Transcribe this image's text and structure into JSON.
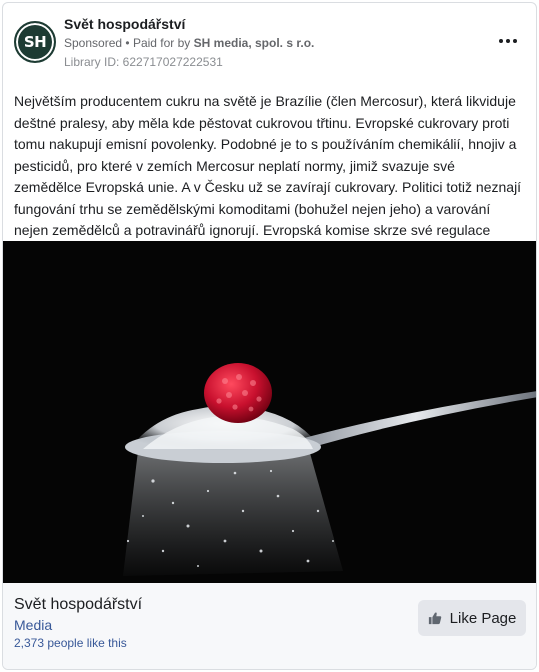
{
  "header": {
    "page_name": "Svět hospodářství",
    "avatar_text": "SH",
    "sponsored_label": "Sponsored",
    "separator": "•",
    "paid_for_prefix": "Paid for by",
    "paid_for_by": "SH media, spol. s r.o.",
    "library_id": "Library ID: 622717027222531",
    "more_icon": "more-horizontal-icon"
  },
  "post": {
    "text": "Největším producentem cukru na světě je Brazílie (člen Mercosur), která likviduje deštné pralesy, aby měla kde pěstovat cukrovou třtinu. Evropské cukrovary proti tomu nakupují emisní povolenky. Podobné je to s používáním chemikálií, hnojiv a pesticidů, pro které v zemích Mercosur neplatí normy, jimiž svazuje své zemědělce Evropská unie. A v Česku už se zavírají cukrovary. Politici totiž neznají fungování trhu se zemědělskými komoditami (bohužel nejen jeho) a varování nejen zemědělců a potravinářů ignorují. Evropská komise skrze své regulace zvysoka…"
  },
  "image": {
    "subject": "raspberry on a spoon of sugar",
    "background_color": "#050505"
  },
  "footer": {
    "page_name": "Svět hospodářství",
    "category": "Media",
    "likes": "2,373 people like this",
    "like_button_label": "Like Page",
    "like_icon": "thumbs-up-icon"
  },
  "colors": {
    "link": "#385898",
    "muted": "#65676b",
    "button_bg": "#e4e6eb",
    "avatar_bg": "#1d3b33"
  }
}
